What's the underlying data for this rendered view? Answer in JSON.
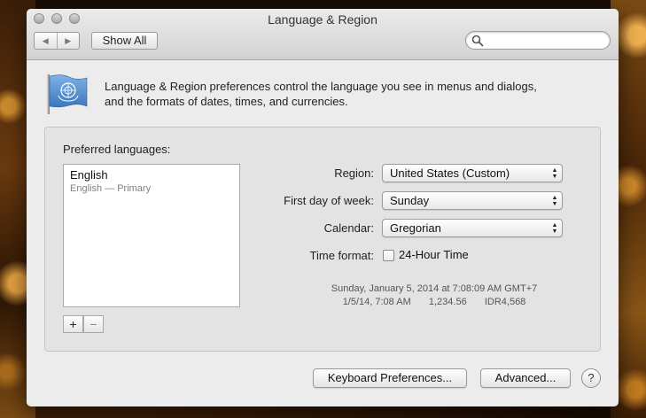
{
  "window": {
    "title": "Language & Region"
  },
  "toolbar": {
    "back_icon": "◀",
    "forward_icon": "▶",
    "show_all_label": "Show All",
    "search_placeholder": "",
    "search_value": ""
  },
  "description": {
    "line1": "Language & Region preferences control the language you see in menus and dialogs,",
    "line2": "and the formats of dates, times, and currencies."
  },
  "preferred_languages": {
    "label": "Preferred languages:",
    "items": [
      {
        "name": "English",
        "detail": "English — Primary"
      }
    ],
    "add_label": "+",
    "remove_label": "−"
  },
  "settings": {
    "region_label": "Region:",
    "region_value": "United States (Custom)",
    "first_day_label": "First day of week:",
    "first_day_value": "Sunday",
    "calendar_label": "Calendar:",
    "calendar_value": "Gregorian",
    "time_format_label": "Time format:",
    "time_format_checkbox_label": "24-Hour Time",
    "time_format_24h": false
  },
  "samples": {
    "line1": "Sunday, January 5, 2014 at 7:08:09 AM GMT+7",
    "line2_date": "1/5/14, 7:08 AM",
    "line2_number": "1,234.56",
    "line2_currency": "IDR4,568"
  },
  "buttons": {
    "keyboard_preferences": "Keyboard Preferences...",
    "advanced": "Advanced...",
    "help": "?"
  },
  "colors": {
    "window_bg": "#ececec",
    "panel_bg": "#e3e3e3",
    "flag_blue": "#4a86c8"
  }
}
